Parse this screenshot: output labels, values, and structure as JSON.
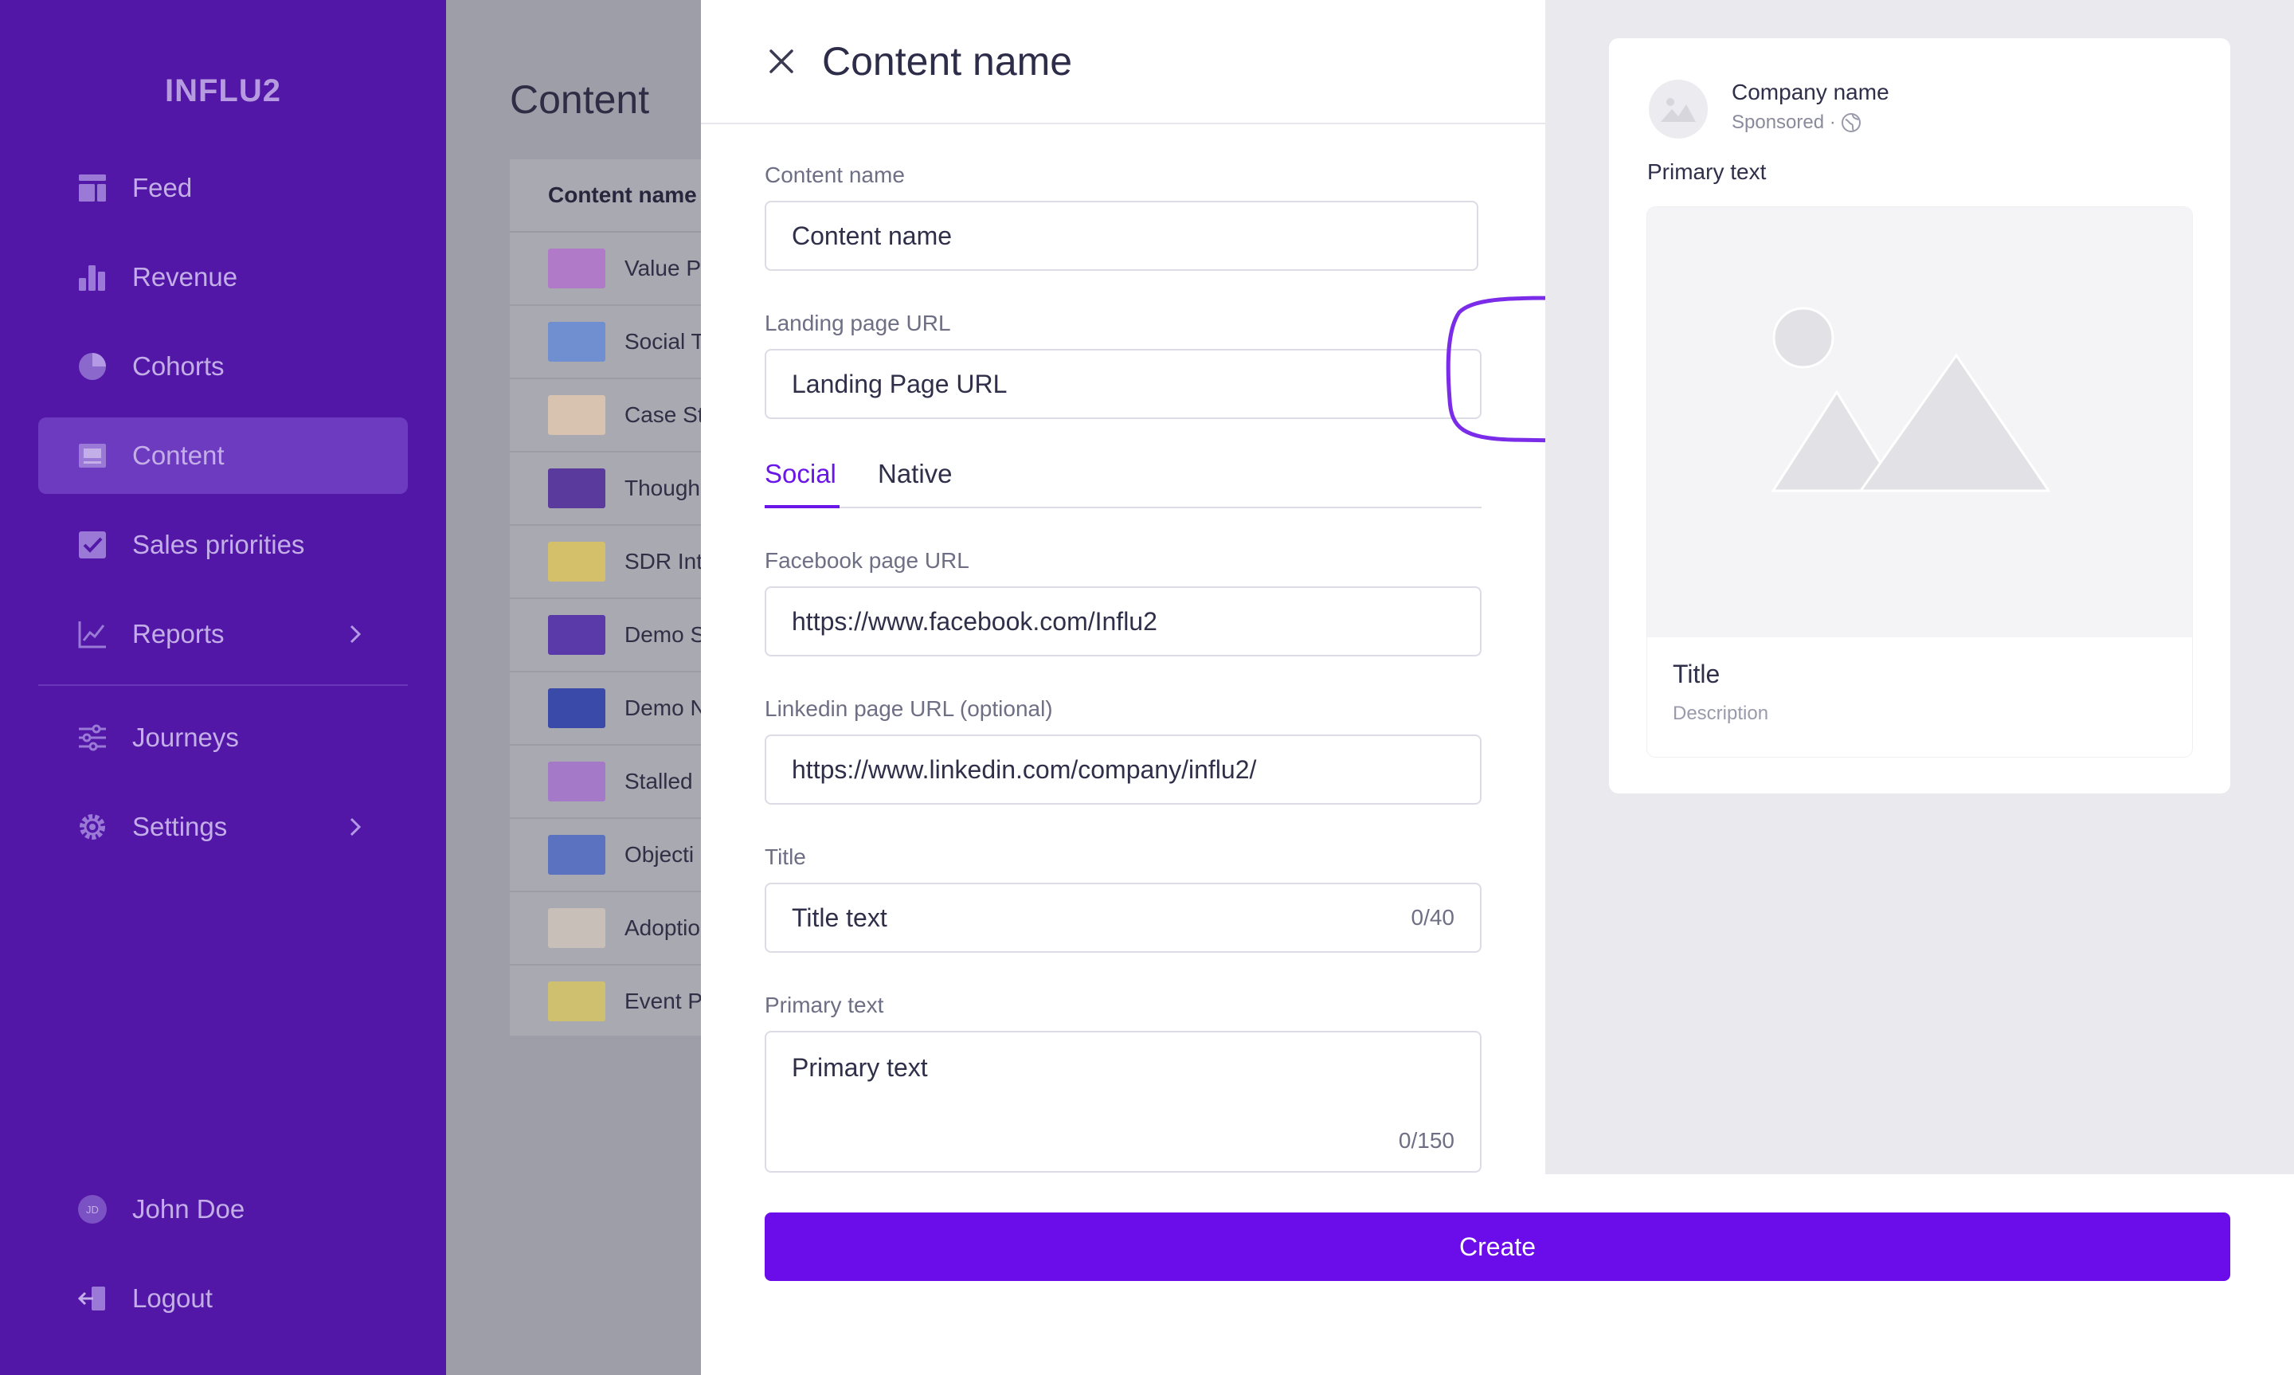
{
  "app": {
    "logo": "INFLU2"
  },
  "sidebar": {
    "items": [
      {
        "label": "Feed",
        "icon": "feed-icon"
      },
      {
        "label": "Revenue",
        "icon": "bar-chart-icon"
      },
      {
        "label": "Cohorts",
        "icon": "pie-chart-icon"
      },
      {
        "label": "Content",
        "icon": "content-icon",
        "active": true
      },
      {
        "label": "Sales priorities",
        "icon": "checkbox-icon"
      },
      {
        "label": "Reports",
        "icon": "line-chart-icon"
      },
      {
        "label": "Journeys",
        "icon": "sliders-icon"
      },
      {
        "label": "Settings",
        "icon": "gear-icon"
      }
    ],
    "user": {
      "name": "John Doe",
      "initials": "JD"
    },
    "logout": "Logout"
  },
  "background": {
    "title": "Content",
    "column_header": "Content name",
    "rows": [
      "Value P",
      "Social T",
      "Case St",
      "Though",
      "SDR Int",
      "Demo S",
      "Demo N",
      "Stalled",
      "Objecti",
      "Adoptio",
      "Event P"
    ]
  },
  "modal": {
    "title": "Content name",
    "content_name": {
      "label": "Content name",
      "value": "Content name"
    },
    "landing_url": {
      "label": "Landing page URL",
      "value": "Landing Page URL"
    },
    "tabs": {
      "social": "Social",
      "native": "Native"
    },
    "facebook": {
      "label": "Facebook page URL",
      "value": "https://www.facebook.com/Influ2"
    },
    "linkedin": {
      "label": "Linkedin page URL (optional)",
      "value": "https://www.linkedin.com/company/influ2/"
    },
    "title_field": {
      "label": "Title",
      "value": "Title text",
      "counter": "0/40"
    },
    "primary_text": {
      "label": "Primary text",
      "value": "Primary text",
      "counter": "0/150"
    },
    "create_label": "Create"
  },
  "preview": {
    "company": "Company name",
    "sponsored": "Sponsored ·",
    "primary_text": "Primary text",
    "title": "Title",
    "description": "Description"
  },
  "colors": {
    "sidebar_bg": "#5217a6",
    "sidebar_active": "#6c3bbf",
    "accent": "#6b16e8",
    "button": "#6b0ceb",
    "annotation": "#7a2ce8"
  }
}
